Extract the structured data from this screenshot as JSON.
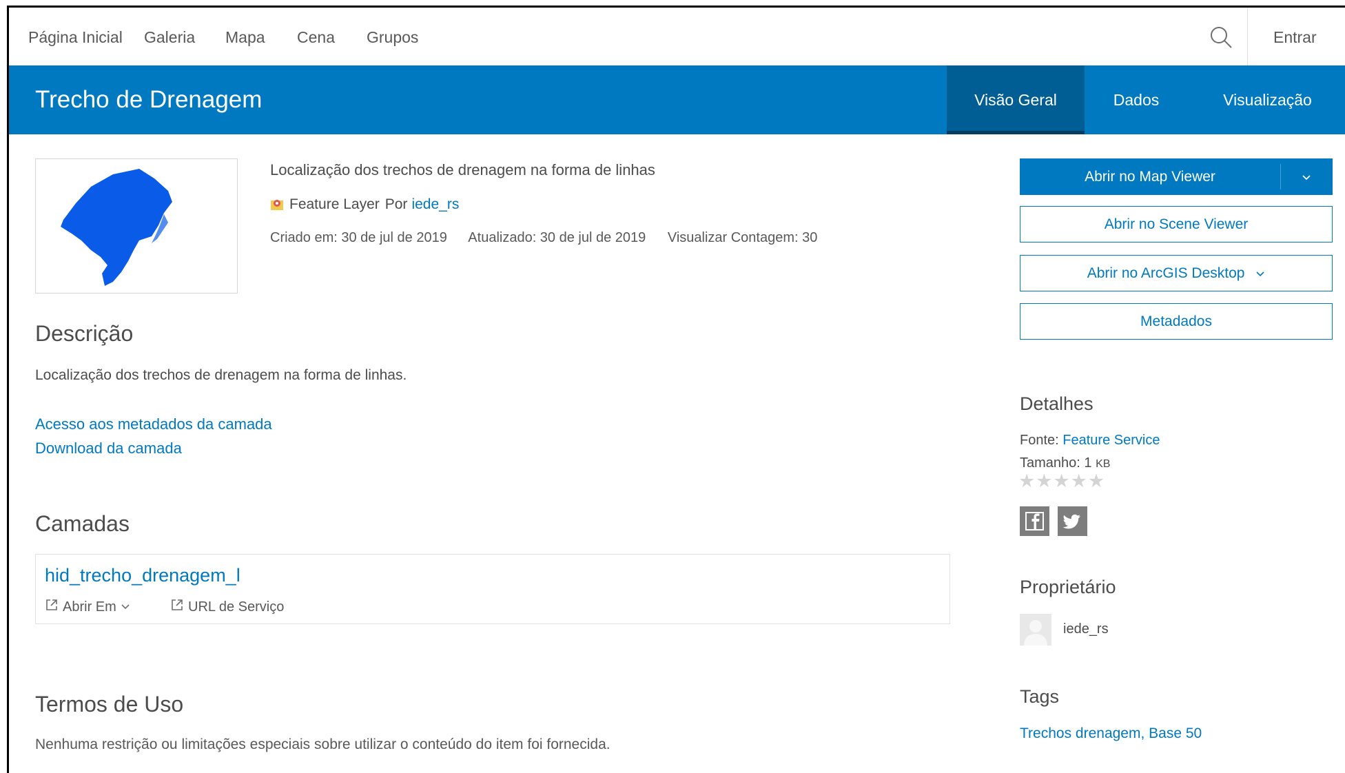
{
  "nav": {
    "items": [
      "Página Inicial",
      "Galeria",
      "Mapa",
      "Cena",
      "Grupos"
    ],
    "search_icon": "search-icon",
    "signin": "Entrar"
  },
  "header": {
    "title": "Trecho de Drenagem",
    "tabs": [
      "Visão Geral",
      "Dados",
      "Visualização"
    ],
    "active_tab": "Visão Geral"
  },
  "item": {
    "summary": "Localização dos trechos de drenagem na forma de linhas",
    "type": "Feature Layer",
    "by_label": "Por",
    "owner_link": "iede_rs",
    "created": "Criado em: 30 de jul de 2019",
    "updated": "Atualizado: 30 de jul de 2019",
    "views": "Visualizar Contagem: 30"
  },
  "description": {
    "heading": "Descrição",
    "text": "Localização dos trechos de drenagem na forma de linhas.",
    "links": [
      "Acesso aos metadados da camada",
      "Download da camada"
    ]
  },
  "layers": {
    "heading": "Camadas",
    "name": "hid_trecho_drenagem_l",
    "open_in": "Abrir Em",
    "service_url": "URL de Serviço"
  },
  "terms": {
    "heading": "Termos de Uso",
    "text": "Nenhuma restrição ou limitações especiais sobre utilizar o conteúdo do item foi fornecida."
  },
  "actions": {
    "map_viewer": "Abrir no Map Viewer",
    "scene_viewer": "Abrir no Scene Viewer",
    "arcgis_desktop": "Abrir no ArcGIS Desktop",
    "metadata": "Metadados"
  },
  "details": {
    "heading": "Detalhes",
    "source_label": "Fonte:",
    "source_value": "Feature Service",
    "size_label": "Tamanho:",
    "size_value": "1",
    "size_unit": "KB",
    "rating": 0,
    "rating_max": 5,
    "social": [
      "facebook-icon",
      "twitter-icon"
    ]
  },
  "owner": {
    "heading": "Proprietário",
    "name": "iede_rs"
  },
  "tags": {
    "heading": "Tags",
    "list": "Trechos drenagem, Base 50"
  },
  "colors": {
    "brand": "#0079c1",
    "active_tab": "#005e95",
    "thumbnail_fill": "#0a5ce8"
  }
}
